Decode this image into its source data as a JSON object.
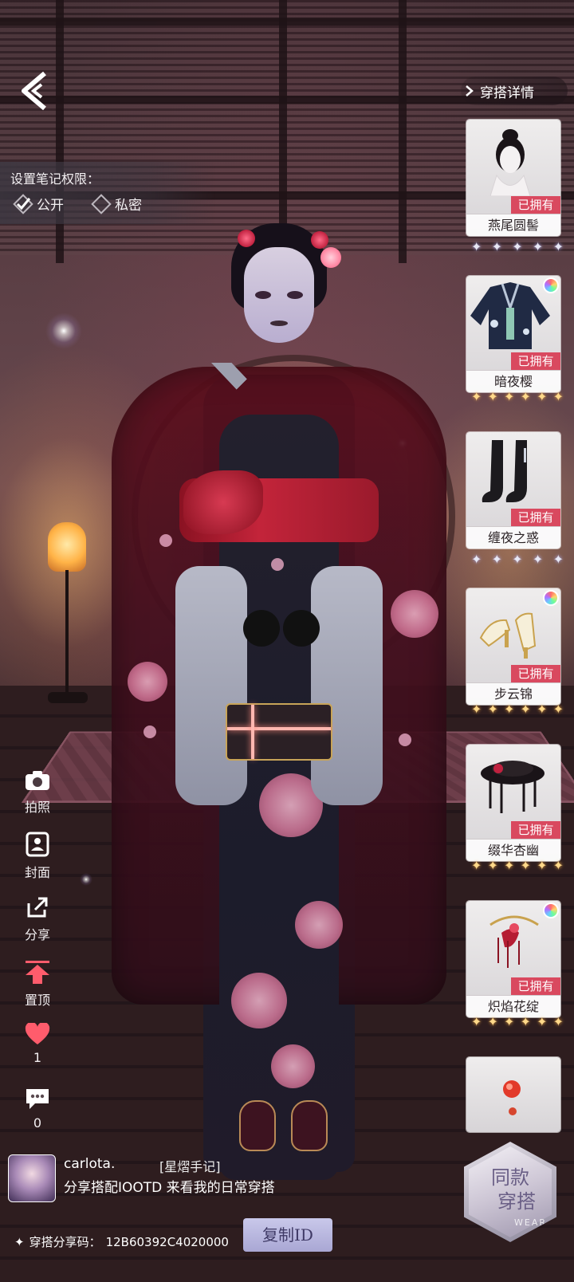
{
  "header": {
    "back_icon": "back-chevron-icon",
    "detail_link_label": "穿搭详情"
  },
  "permission": {
    "title": "设置笔记权限：",
    "options": [
      {
        "label": "公开",
        "selected": true
      },
      {
        "label": "私密",
        "selected": false
      }
    ]
  },
  "side_actions": [
    {
      "label": "拍照",
      "icon": "camera-icon"
    },
    {
      "label": "封面",
      "icon": "cover-icon"
    },
    {
      "label": "分享",
      "icon": "share-icon"
    },
    {
      "label": "置顶",
      "icon": "pin-top-icon"
    },
    {
      "label": "1",
      "icon": "heart-icon"
    },
    {
      "label": "0",
      "icon": "comment-icon"
    }
  ],
  "items": [
    {
      "name": "燕尾圆髻",
      "owned_label": "已拥有",
      "stars": 5,
      "star_color": "silver",
      "rainbow": false,
      "icon": "hairstyle-icon"
    },
    {
      "name": "暗夜樱",
      "owned_label": "已拥有",
      "stars": 6,
      "star_color": "gold",
      "rainbow": true,
      "icon": "kimono-icon"
    },
    {
      "name": "缠夜之惑",
      "owned_label": "已拥有",
      "stars": 5,
      "star_color": "silver",
      "rainbow": false,
      "icon": "stockings-icon"
    },
    {
      "name": "步云锦",
      "owned_label": "已拥有",
      "stars": 6,
      "star_color": "gold",
      "rainbow": true,
      "icon": "shoes-icon"
    },
    {
      "name": "缀华杏幽",
      "owned_label": "已拥有",
      "stars": 6,
      "star_color": "gold",
      "rainbow": false,
      "icon": "hat-icon"
    },
    {
      "name": "炽焰花绽",
      "owned_label": "已拥有",
      "stars": 6,
      "star_color": "gold",
      "rainbow": true,
      "icon": "hair-ornament-icon"
    },
    {
      "name": "",
      "owned_label": "",
      "stars": 0,
      "star_color": "gold",
      "rainbow": false,
      "icon": "earring-icon"
    }
  ],
  "same_outfit": {
    "label_line1": "同款",
    "label_line2": "穿搭",
    "wear": "WEAR"
  },
  "user": {
    "name": "carlota.",
    "tag": "[星熠手记]",
    "description": "分享搭配IOOTD 来看我的日常穿搭"
  },
  "share": {
    "label": "穿搭分享码：",
    "code": "12B60392C4020000",
    "copy_label": "复制ID"
  },
  "colors": {
    "owned_badge": "#d9495f",
    "copy_button": "#b9b7e0",
    "heart": "#ff5c6c",
    "pin": "#ff5c6c"
  }
}
